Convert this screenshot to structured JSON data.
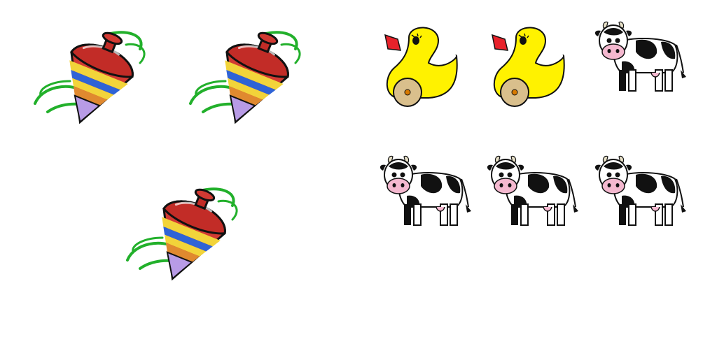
{
  "groups": [
    {
      "name": "left-group",
      "items": [
        "spinning-top",
        "spinning-top",
        "spinning-top"
      ]
    },
    {
      "name": "right-group",
      "items": [
        "rubber-duck",
        "rubber-duck",
        "cow",
        "cow",
        "cow",
        "cow"
      ]
    }
  ],
  "colors": {
    "background": "#ffffff",
    "top_red": "#d23a33",
    "top_yellow": "#f2d43a",
    "top_blue": "#2f63d6",
    "top_purple": "#b89be6",
    "swirl_green": "#22b02b",
    "duck_yellow": "#fff200",
    "duck_beak": "#e8222b",
    "wheel_tan": "#d9bf8c",
    "cow_pink": "#f4b8cf"
  }
}
